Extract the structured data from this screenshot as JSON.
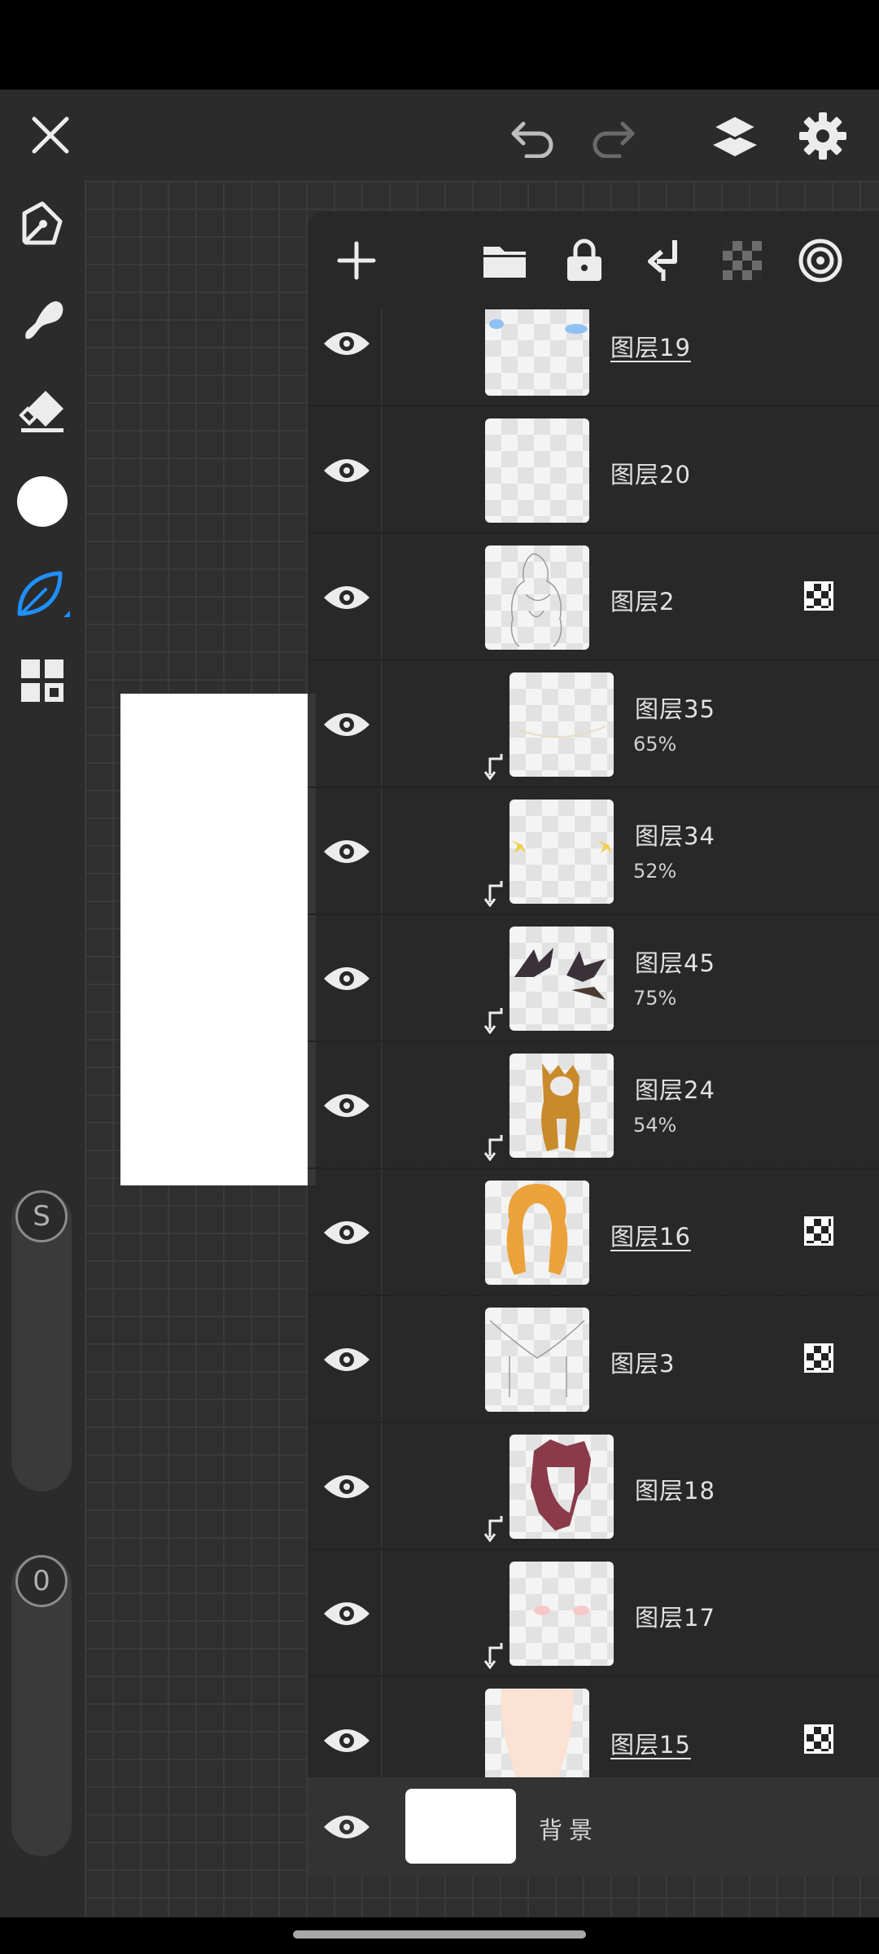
{
  "top_bar": {
    "close_icon": "close-icon",
    "undo_icon": "undo-icon",
    "redo_icon": "redo-icon",
    "layers_icon": "layers-icon",
    "settings_icon": "gear-icon"
  },
  "left_toolbar": {
    "tools": [
      "pen-tool-icon",
      "smudge-tool-icon",
      "eraser-icon",
      "color-swatch",
      "leaf-brush-icon",
      "grid-menu-icon"
    ],
    "size_slider_label": "S",
    "opacity_slider_label": "0"
  },
  "layer_panel": {
    "tools": [
      "add-layer-icon",
      "folder-icon",
      "lock-icon",
      "clipping-icon",
      "alpha-lock-icon",
      "blend-mode-icon"
    ],
    "layers": [
      {
        "name": "图层19",
        "opacity": "",
        "clipped": false,
        "underlined": true,
        "alpha_locked": false
      },
      {
        "name": "图层20",
        "opacity": "",
        "clipped": false,
        "underlined": false,
        "alpha_locked": false
      },
      {
        "name": "图层2",
        "opacity": "",
        "clipped": false,
        "underlined": false,
        "alpha_locked": true
      },
      {
        "name": "图层35",
        "opacity": "65%",
        "clipped": true,
        "underlined": false,
        "alpha_locked": false
      },
      {
        "name": "图层34",
        "opacity": "52%",
        "clipped": true,
        "underlined": false,
        "alpha_locked": false
      },
      {
        "name": "图层45",
        "opacity": "75%",
        "clipped": true,
        "underlined": false,
        "alpha_locked": false
      },
      {
        "name": "图层24",
        "opacity": "54%",
        "clipped": true,
        "underlined": false,
        "alpha_locked": false
      },
      {
        "name": "图层16",
        "opacity": "",
        "clipped": false,
        "underlined": true,
        "alpha_locked": true
      },
      {
        "name": "图层3",
        "opacity": "",
        "clipped": false,
        "underlined": false,
        "alpha_locked": true
      },
      {
        "name": "图层18",
        "opacity": "",
        "clipped": true,
        "underlined": false,
        "alpha_locked": false
      },
      {
        "name": "图层17",
        "opacity": "",
        "clipped": true,
        "underlined": false,
        "alpha_locked": false
      },
      {
        "name": "图层15",
        "opacity": "",
        "clipped": false,
        "underlined": true,
        "alpha_locked": true
      }
    ],
    "background_label": "背景"
  },
  "colors": {
    "accent_blue": "#1e90ff",
    "panel_bg": "#282828",
    "icon_white": "#ececec"
  }
}
